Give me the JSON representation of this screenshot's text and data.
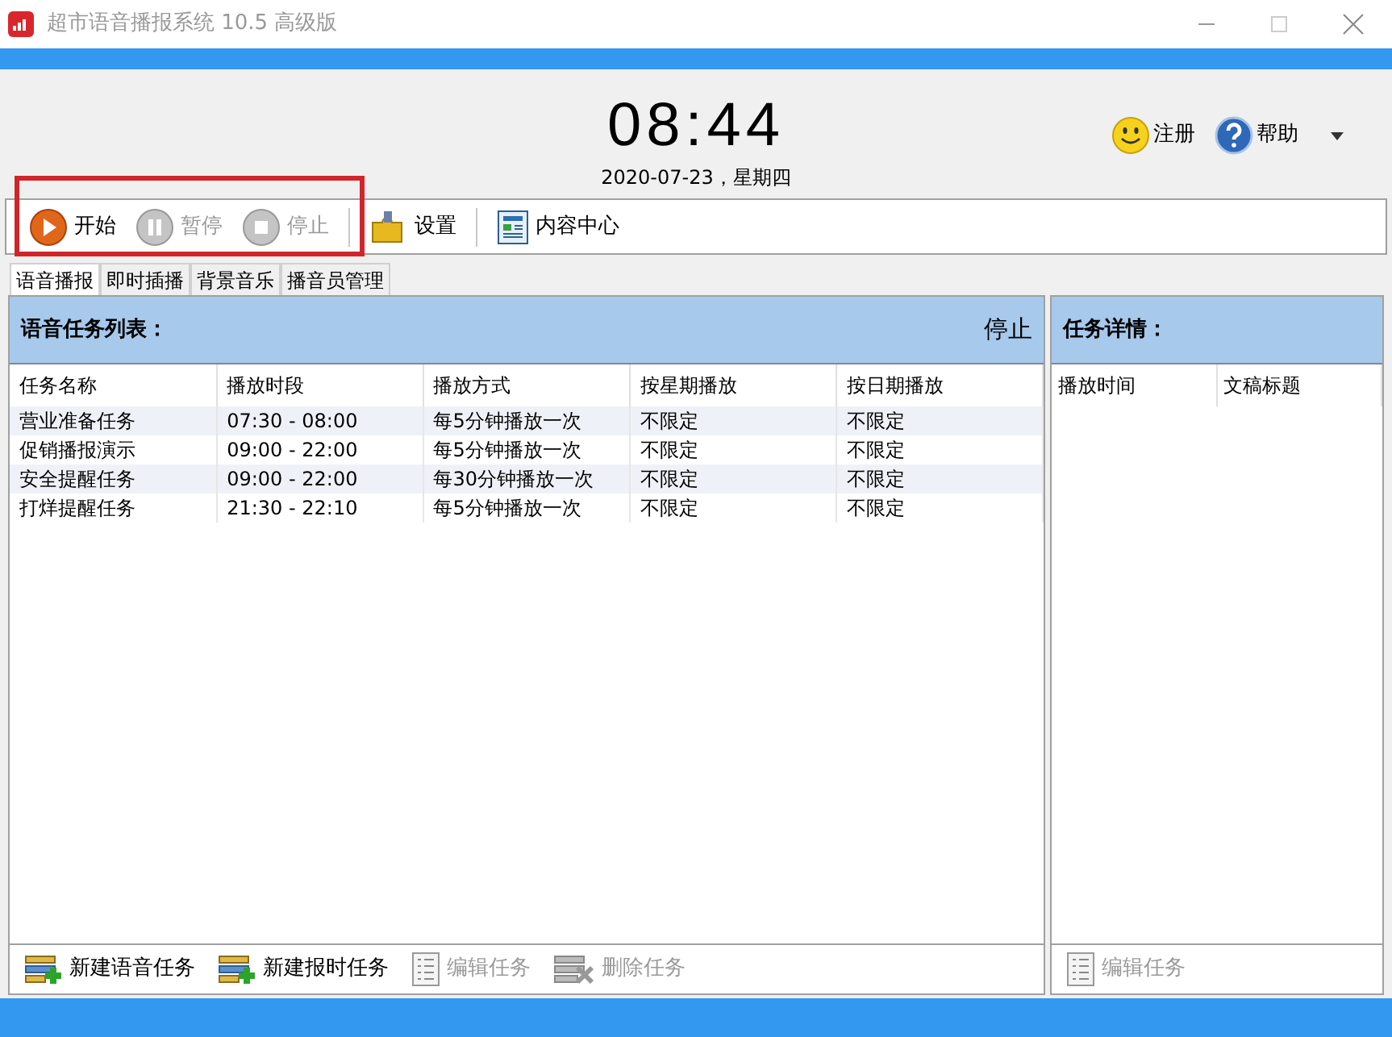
{
  "window": {
    "title": "超市语音播报系统 10.5 高级版"
  },
  "clock": {
    "time": "08:44",
    "date": "2020-07-23，星期四"
  },
  "header_links": [
    {
      "kind": "register",
      "label": "注册"
    },
    {
      "kind": "help",
      "label": "帮助"
    }
  ],
  "toolbar": [
    {
      "kind": "play",
      "label": "开始",
      "disabled": false
    },
    {
      "kind": "pause",
      "label": "暂停",
      "disabled": true
    },
    {
      "kind": "stop",
      "label": "停止",
      "disabled": true
    },
    {
      "kind": "settings",
      "label": "设置",
      "disabled": false
    },
    {
      "kind": "content",
      "label": "内容中心",
      "disabled": false
    }
  ],
  "tabs": [
    {
      "label": "语音播报",
      "selected": true
    },
    {
      "label": "即时插播",
      "selected": false
    },
    {
      "label": "背景音乐",
      "selected": false
    },
    {
      "label": "播音员管理",
      "selected": false
    }
  ],
  "task_list": {
    "title": "语音任务列表：",
    "status": "停止",
    "columns": [
      "任务名称",
      "播放时段",
      "播放方式",
      "按星期播放",
      "按日期播放"
    ],
    "rows": [
      [
        "营业准备任务",
        "07:30 - 08:00",
        "每5分钟播放一次",
        "不限定",
        "不限定"
      ],
      [
        "促销播报演示",
        "09:00 - 22:00",
        "每5分钟播放一次",
        "不限定",
        "不限定"
      ],
      [
        "安全提醒任务",
        "09:00 - 22:00",
        "每30分钟播放一次",
        "不限定",
        "不限定"
      ],
      [
        "打烊提醒任务",
        "21:30 - 22:10",
        "每5分钟播放一次",
        "不限定",
        "不限定"
      ]
    ],
    "actions": [
      {
        "kind": "add",
        "label": "新建语音任务",
        "disabled": false
      },
      {
        "kind": "add",
        "label": "新建报时任务",
        "disabled": false
      },
      {
        "kind": "edit",
        "label": "编辑任务",
        "disabled": true
      },
      {
        "kind": "delete",
        "label": "删除任务",
        "disabled": true
      }
    ]
  },
  "task_details": {
    "title": "任务详情：",
    "columns": [
      "播放时间",
      "文稿标题"
    ],
    "actions": [
      {
        "kind": "edit",
        "label": "编辑任务",
        "disabled": true
      }
    ]
  }
}
